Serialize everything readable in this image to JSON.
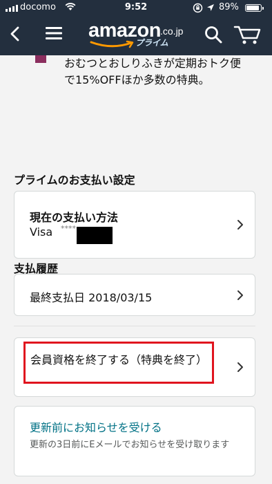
{
  "status_bar": {
    "carrier": "docomo",
    "time": "9:52",
    "battery": "89%",
    "battery_level": 0.89
  },
  "header": {
    "logo_text": "amazon",
    "logo_tld": ".co.jp",
    "logo_sub": "プライム"
  },
  "promo": {
    "text": "おむつとおしりふきが定期おトク便で15%OFFほか多数の特典。"
  },
  "payment_settings": {
    "title": "プライムのお支払い設定",
    "method_title": "現在の支払い方法",
    "card_brand": "Visa",
    "card_mask": "****"
  },
  "payment_history": {
    "title": "支払履歴",
    "last_payment": "最終支払日 2018/03/15"
  },
  "membership": {
    "cancel_label": "会員資格を終了する（特典を終了）"
  },
  "notify": {
    "link": "更新前にお知らせを受ける",
    "description": "更新の3日前にEメールでお知らせを受け取ります"
  },
  "colors": {
    "header_bg": "#232f3e",
    "link": "#007185",
    "highlight": "#e0141e",
    "badge": "#8b2e5e"
  }
}
